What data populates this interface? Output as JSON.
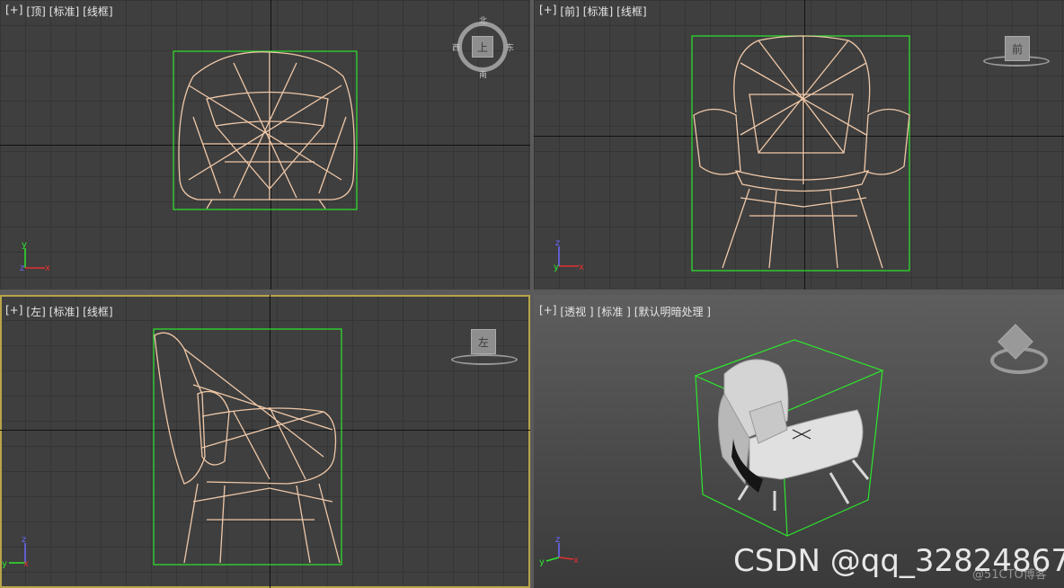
{
  "viewports": [
    {
      "name": "top",
      "labels": [
        "[+]",
        "[顶]",
        "[标准]",
        "[线框]"
      ],
      "cube_label": "上",
      "compass": {
        "n": "北",
        "s": "南",
        "e": "东",
        "w": "西"
      },
      "axes": {
        "a": "y",
        "b": "z",
        "c": "x"
      }
    },
    {
      "name": "front",
      "labels": [
        "[+]",
        "[前]",
        "[标准]",
        "[线框]"
      ],
      "cube_label": "前",
      "axes": {
        "a": "z",
        "b": "y",
        "c": "x"
      }
    },
    {
      "name": "left",
      "labels": [
        "[+]",
        "[左]",
        "[标准]",
        "[线框]"
      ],
      "cube_label": "左",
      "axes": {
        "a": "z",
        "b": "y",
        "c": "x"
      }
    },
    {
      "name": "perspective",
      "labels": [
        "[+]",
        "[透视 ]",
        "[标准 ]",
        "[默认明暗处理 ]"
      ],
      "cube_label": "",
      "axes": {
        "a": "z",
        "b": "y",
        "c": "x"
      }
    }
  ],
  "colors": {
    "wire": "#f0c8a8",
    "bbox": "#2ee62e",
    "grid": "#353535",
    "active_border": "#b8a44a"
  },
  "watermark": "CSDN @qq_32824867",
  "watermark_faint": "@51CTO博客"
}
